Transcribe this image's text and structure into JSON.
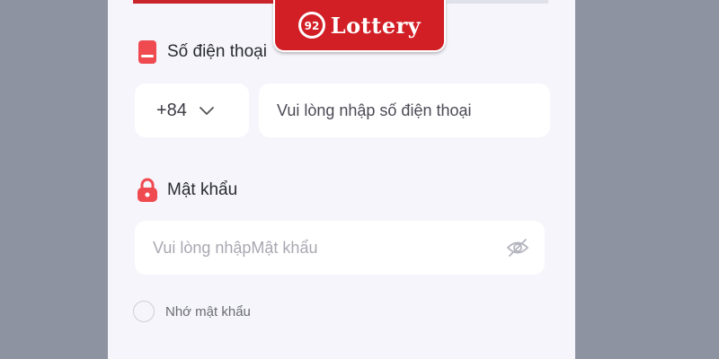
{
  "brand": {
    "logo_text": "Lottery",
    "logo_mark": "92"
  },
  "phone": {
    "label": "Số điện thoại",
    "country_code": "+84",
    "placeholder": "Vui lòng nhập số điện thoại"
  },
  "password": {
    "label": "Mật khẩu",
    "placeholder": "Vui lòng nhậpMật khẩu"
  },
  "remember": {
    "label": "Nhớ mật khẩu"
  },
  "colors": {
    "brand_red": "#d21f26",
    "panel_bg": "#f5f5fb",
    "page_bg": "#8e93a1",
    "icon_red": "#ef4a4f"
  }
}
